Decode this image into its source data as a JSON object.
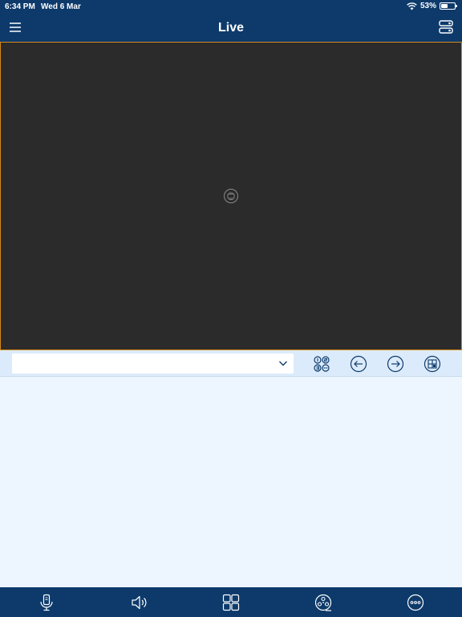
{
  "status_bar": {
    "time": "6:34 PM",
    "date": "Wed 6 Mar",
    "battery_text": "53%",
    "battery_level": 0.53
  },
  "header": {
    "title": "Live",
    "menu_icon": "menu-icon",
    "device_list_icon": "device-list-icon"
  },
  "video": {
    "placeholder_icon": "video-placeholder-icon"
  },
  "toolbar": {
    "channel_select_value": "",
    "buttons": [
      "channel-numbers-icon",
      "previous-icon",
      "next-icon",
      "layout-grid-icon"
    ]
  },
  "tab_bar": {
    "items": [
      "talk-icon",
      "audio-icon",
      "split-screen-icon",
      "ptz-icon",
      "more-icon"
    ]
  },
  "colors": {
    "brand_navy": "#0d3a6b",
    "video_bg": "#2b2b2b",
    "video_border": "#d6891a",
    "panel_bg": "#edf5fe"
  }
}
